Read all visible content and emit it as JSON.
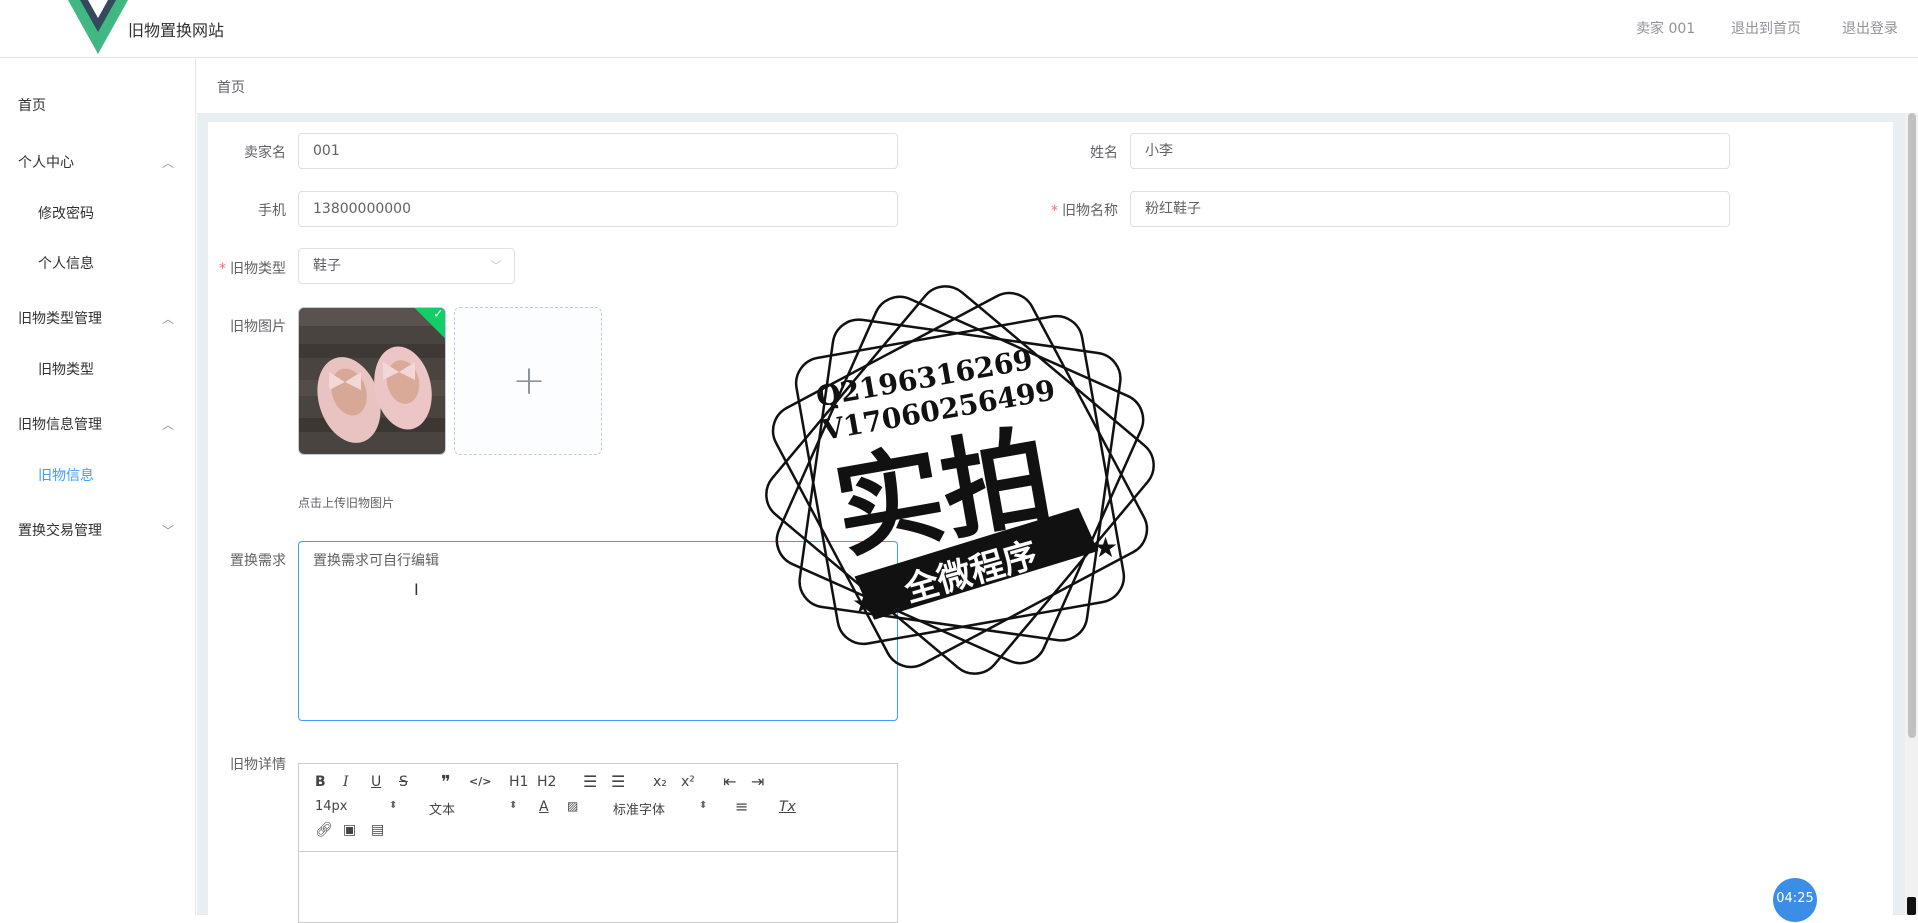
{
  "header": {
    "site_title": "旧物置换网站",
    "user": "卖家 001",
    "home_link": "退出到首页",
    "logout": "退出登录"
  },
  "sidebar": {
    "items": [
      {
        "label": "首页"
      },
      {
        "label": "个人中心"
      },
      {
        "label": "修改密码"
      },
      {
        "label": "个人信息"
      },
      {
        "label": "旧物类型管理"
      },
      {
        "label": "旧物类型"
      },
      {
        "label": "旧物信息管理"
      },
      {
        "label": "旧物信息"
      },
      {
        "label": "置换交易管理"
      }
    ]
  },
  "breadcrumb": "首页",
  "form": {
    "seller_label": "卖家名",
    "seller_value": "001",
    "name_label": "姓名",
    "name_value": "小李",
    "phone_label": "手机",
    "phone_value": "13800000000",
    "item_name_label": "旧物名称",
    "item_name_value": "粉红鞋子",
    "type_label": "旧物类型",
    "type_value": "鞋子",
    "image_label": "旧物图片",
    "upload_tip": "点击上传旧物图片",
    "demand_label": "置换需求",
    "demand_value": "置换需求可自行编辑",
    "detail_label": "旧物详情",
    "required_mark": "*"
  },
  "editor": {
    "font_size": "14px",
    "heading": "文本",
    "font_family": "标准字体",
    "bold": "B",
    "italic": "I",
    "underline": "U",
    "strike": "S",
    "quote": "❞",
    "code": "</>",
    "h1": "H1",
    "h2": "H2",
    "sub": "x₂",
    "sup": "x²",
    "clean": "Tx",
    "color_a": "A"
  },
  "watermark": {
    "line1": "Q2196316269",
    "line2": "V17060256499",
    "main": "实拍",
    "banner": "全微程序"
  },
  "timer": "04:25"
}
